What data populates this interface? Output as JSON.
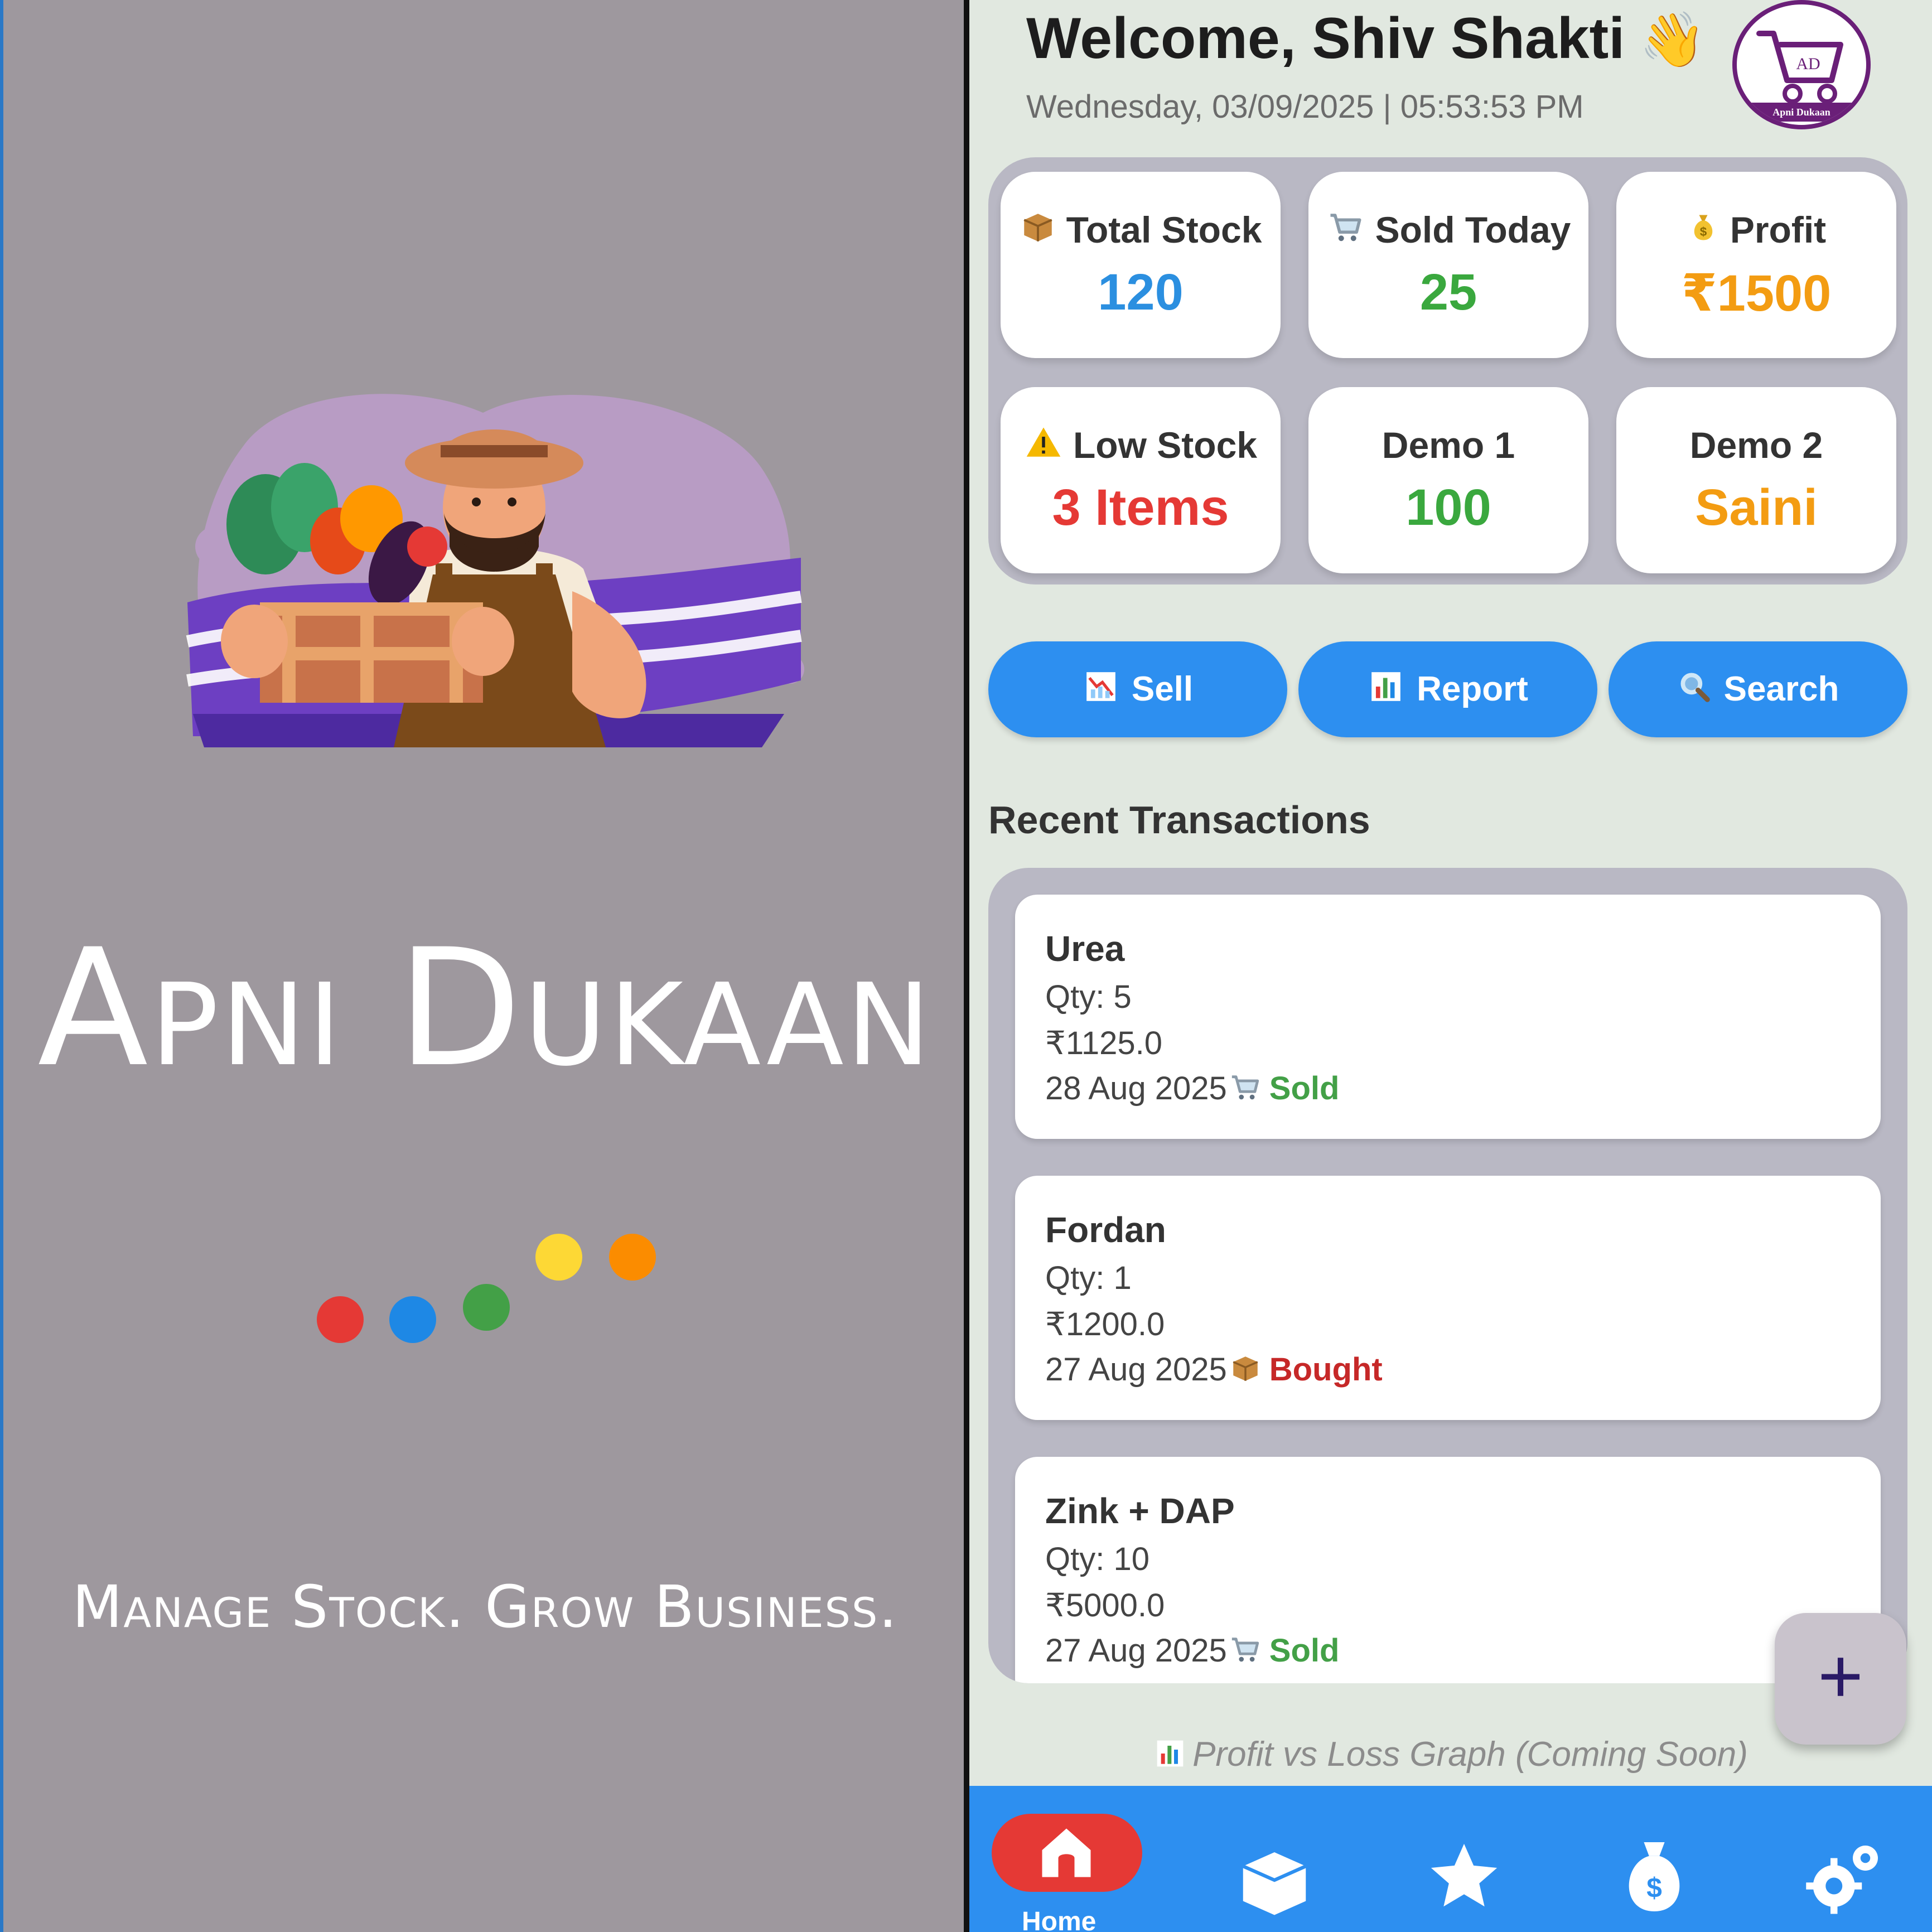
{
  "splash": {
    "app_name": "Apni Dukaan",
    "tagline": "Manage Stock. Grow Business.",
    "loader_dot_colors": [
      "#e53935",
      "#1e88e5",
      "#43a047",
      "#fdd835",
      "#fb8c00"
    ]
  },
  "header": {
    "welcome": "Welcome, Shiv Shakti",
    "wave_emoji": "👋",
    "datetime": "Wednesday, 03/09/2025 | 05:53:53 PM",
    "logo_text": "AD",
    "logo_caption": "Apni Dukaan"
  },
  "stats": [
    {
      "icon": "package-icon",
      "label": "Total Stock",
      "value": "120",
      "color": "#2b8fe0"
    },
    {
      "icon": "cart-icon",
      "label": "Sold Today",
      "value": "25",
      "color": "#3aa83e"
    },
    {
      "icon": "money-bag-icon",
      "label": "Profit",
      "value": "₹1500",
      "color": "#f39c12"
    },
    {
      "icon": "warning-icon",
      "label": "Low Stock",
      "value": "3 Items",
      "color": "#e53935"
    },
    {
      "icon": "",
      "label": "Demo 1",
      "value": "100",
      "color": "#3aa83e"
    },
    {
      "icon": "",
      "label": "Demo 2",
      "value": "Saini",
      "color": "#f39c12"
    }
  ],
  "actions": [
    {
      "icon": "chart-down-icon",
      "label": "Sell"
    },
    {
      "icon": "bar-chart-icon",
      "label": "Report"
    },
    {
      "icon": "search-icon",
      "label": "Search"
    }
  ],
  "recent": {
    "title": "Recent Transactions",
    "transactions": [
      {
        "name": "Urea",
        "qty": "Qty: 5",
        "amount": "₹1125.0",
        "date": "28 Aug 2025",
        "status": "Sold",
        "status_color": "#43a047",
        "icon": "cart-icon"
      },
      {
        "name": "Fordan",
        "qty": "Qty: 1",
        "amount": "₹1200.0",
        "date": "27 Aug 2025",
        "status": "Bought",
        "status_color": "#c62828",
        "icon": "package-icon"
      },
      {
        "name": "Zink + DAP",
        "qty": "Qty: 10",
        "amount": "₹5000.0",
        "date": "27 Aug 2025",
        "status": "Sold",
        "status_color": "#43a047",
        "icon": "cart-icon"
      }
    ]
  },
  "fab": {
    "label": "+"
  },
  "graph_note": "Profit vs Loss Graph (Coming Soon)",
  "nav": {
    "items": [
      {
        "icon": "home-icon",
        "label": "Home",
        "active": true
      },
      {
        "icon": "box-icon",
        "label": ""
      },
      {
        "icon": "star-icon",
        "label": ""
      },
      {
        "icon": "money-bag-icon",
        "label": ""
      },
      {
        "icon": "gear-icon",
        "label": ""
      }
    ],
    "accent": "#2d8ff0",
    "active_color": "#e53935"
  }
}
